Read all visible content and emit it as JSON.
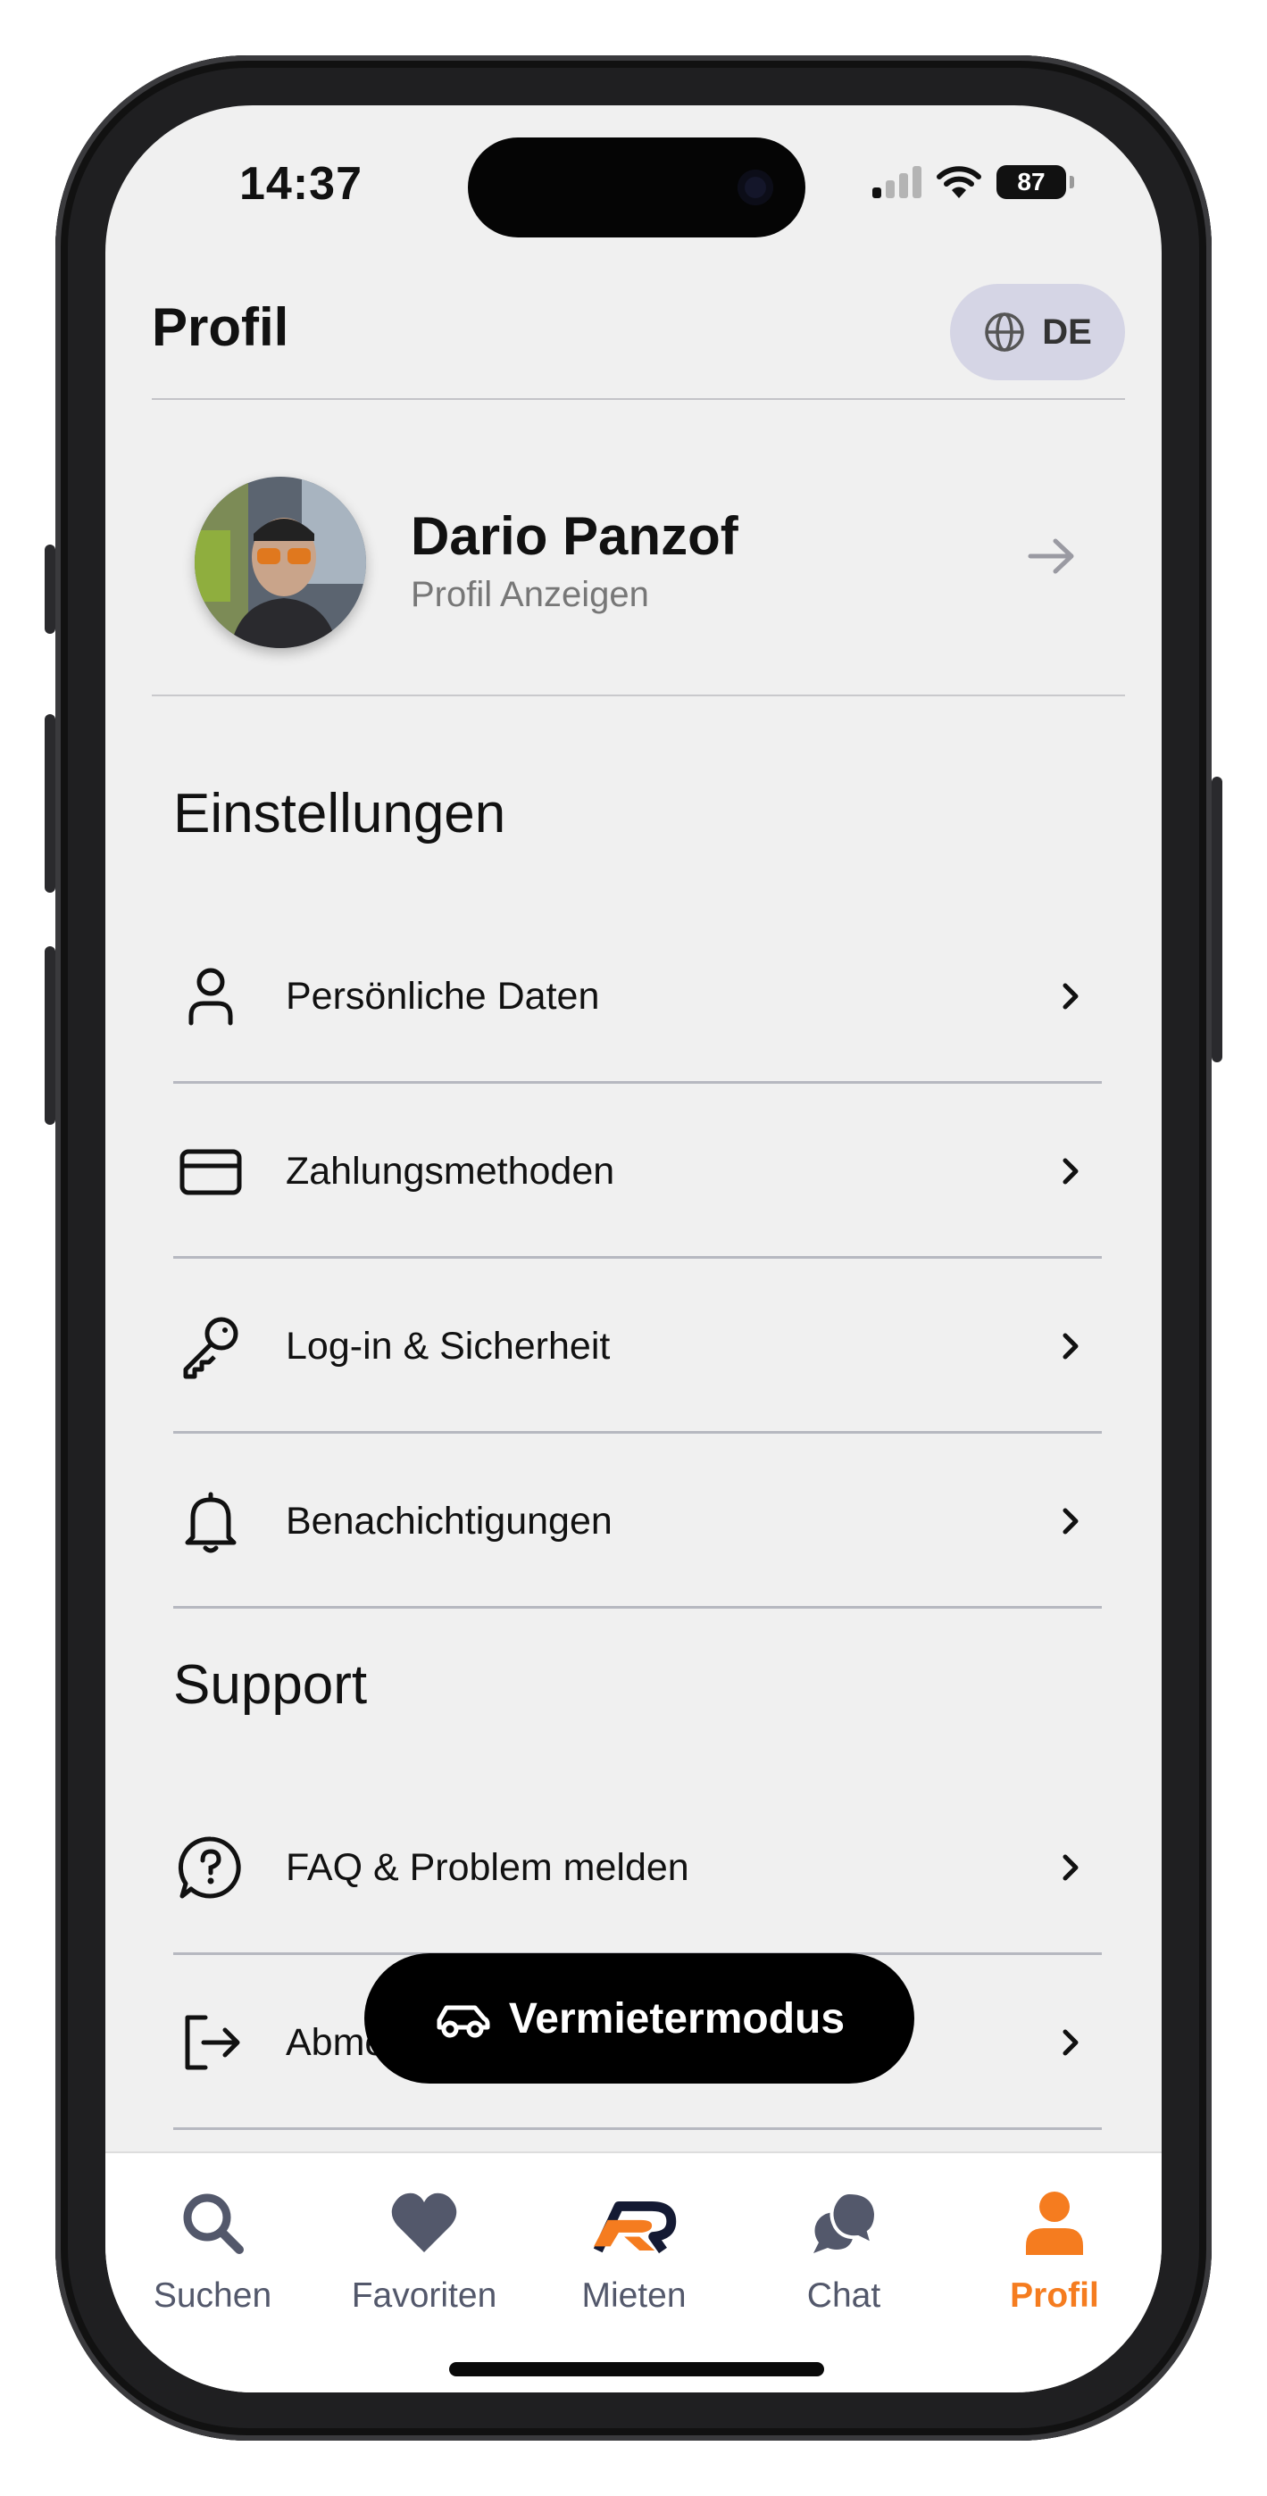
{
  "status_bar": {
    "time": "14:37",
    "battery": "87"
  },
  "header": {
    "title": "Profil",
    "language": "DE"
  },
  "profile": {
    "name": "Dario Panzof",
    "link_label": "Profil Anzeigen"
  },
  "settings": {
    "title": "Einstellungen",
    "items": [
      {
        "label": "Persönliche Daten",
        "icon": "user-icon"
      },
      {
        "label": "Zahlungsmethoden",
        "icon": "credit-card-icon"
      },
      {
        "label": "Log-in & Sicherheit",
        "icon": "key-icon"
      },
      {
        "label": "Benachichtigungen",
        "icon": "bell-icon"
      }
    ]
  },
  "support": {
    "title": "Support",
    "items": [
      {
        "label": "FAQ & Problem melden",
        "icon": "help-chat-icon"
      },
      {
        "label": "Abmelden",
        "icon": "logout-icon"
      }
    ]
  },
  "cta": {
    "label": "Vermietermodus",
    "icon": "car-icon"
  },
  "tabbar": {
    "tabs": [
      {
        "label": "Suchen",
        "icon": "search-icon"
      },
      {
        "label": "Favoriten",
        "icon": "heart-icon"
      },
      {
        "label": "Mieten",
        "icon": "brand-logo-icon"
      },
      {
        "label": "Chat",
        "icon": "chat-icon"
      },
      {
        "label": "Profil",
        "icon": "profile-icon",
        "active": true
      }
    ]
  },
  "colors": {
    "accent": "#f57c1f",
    "background": "#f0f0f0",
    "lang_pill": "#d5d5e5",
    "tab_inactive": "#53586b"
  }
}
